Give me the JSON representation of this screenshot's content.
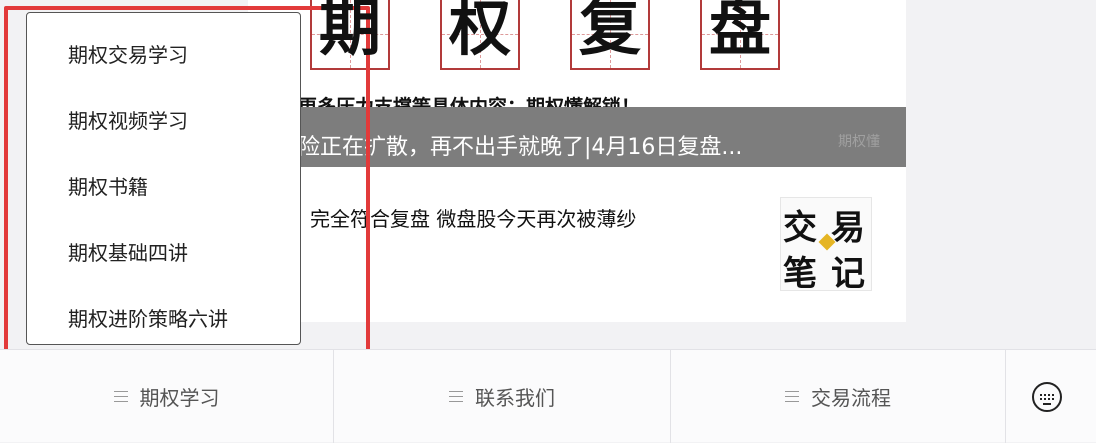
{
  "article": {
    "title_chars": [
      "期",
      "权",
      "复",
      "盘"
    ],
    "subtitle": "更多压力支撑等具体内容：期权懂解锁！",
    "banner_text": "险正在扩散，再不出手就晚了|4月16日复盘...",
    "banner_tag": "期权懂",
    "body_text": "完全符合复盘 微盘股今天再次被薄纱",
    "thumbnail_chars": [
      "交",
      "易",
      "笔",
      "记"
    ]
  },
  "dropdown": {
    "items": [
      "期权交易学习",
      "期权视频学习",
      "期权书籍",
      "期权基础四讲",
      "期权进阶策略六讲"
    ]
  },
  "bottom_tabs": [
    {
      "label": "期权学习",
      "icon": "menu-icon"
    },
    {
      "label": "联系我们",
      "icon": "menu-icon"
    },
    {
      "label": "交易流程",
      "icon": "menu-icon"
    }
  ],
  "keyboard_button": {
    "icon": "keyboard-icon"
  },
  "colors": {
    "highlight": "#e23a3a",
    "title_border": "#b23a3a",
    "banner": "#7d7d7d"
  }
}
